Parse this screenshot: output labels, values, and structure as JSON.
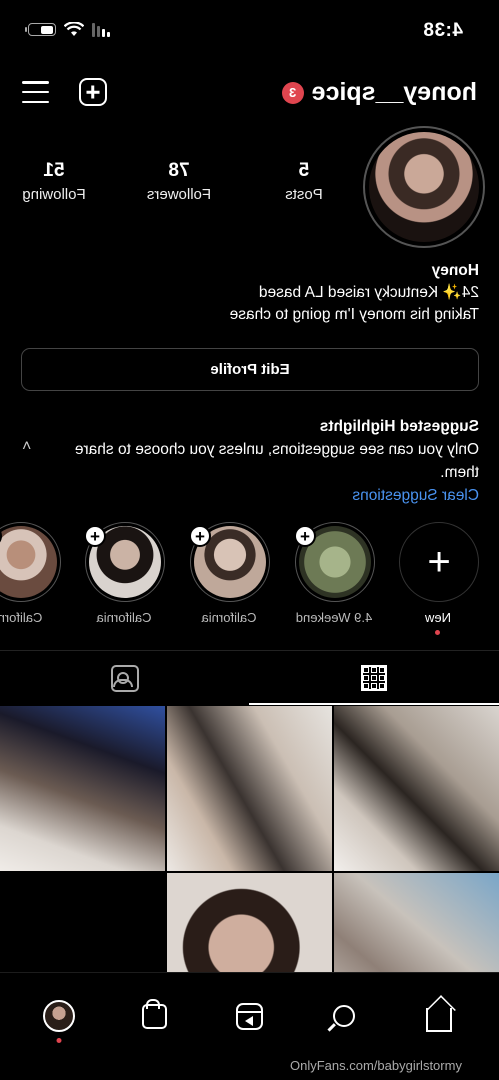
{
  "status_bar": {
    "time": "4:38"
  },
  "header": {
    "username": "honey__spice",
    "notification_count": "3"
  },
  "profile": {
    "stats": [
      {
        "value": "5",
        "label": "Posts"
      },
      {
        "value": "78",
        "label": "Followers"
      },
      {
        "value": "51",
        "label": "Following"
      }
    ],
    "name": "Honey",
    "bio_line1": "24✨ Kentucky raised LA based",
    "bio_line2": "Taking his money I'm going to chase",
    "edit_label": "Edit Profile"
  },
  "suggestions": {
    "title": "Suggested Highlights",
    "text": "Only you can see suggestions, unless you choose to share them.",
    "link": "Clear Suggestions"
  },
  "highlights": [
    {
      "label": "New"
    },
    {
      "label": "4.9 Weekend"
    },
    {
      "label": "California"
    },
    {
      "label": "California"
    },
    {
      "label": "Californ"
    }
  ],
  "watermark": "OnlyFans.com/babygirlstormy",
  "colors": {
    "accent_red": "#e0454f",
    "link_blue": "#4a93f0",
    "background": "#000000"
  },
  "icons": {
    "bottom_nav": [
      "home-icon",
      "search-icon",
      "reels-icon",
      "shop-icon",
      "profile-avatar"
    ],
    "tabs": [
      "grid-icon",
      "tagged-icon"
    ]
  }
}
